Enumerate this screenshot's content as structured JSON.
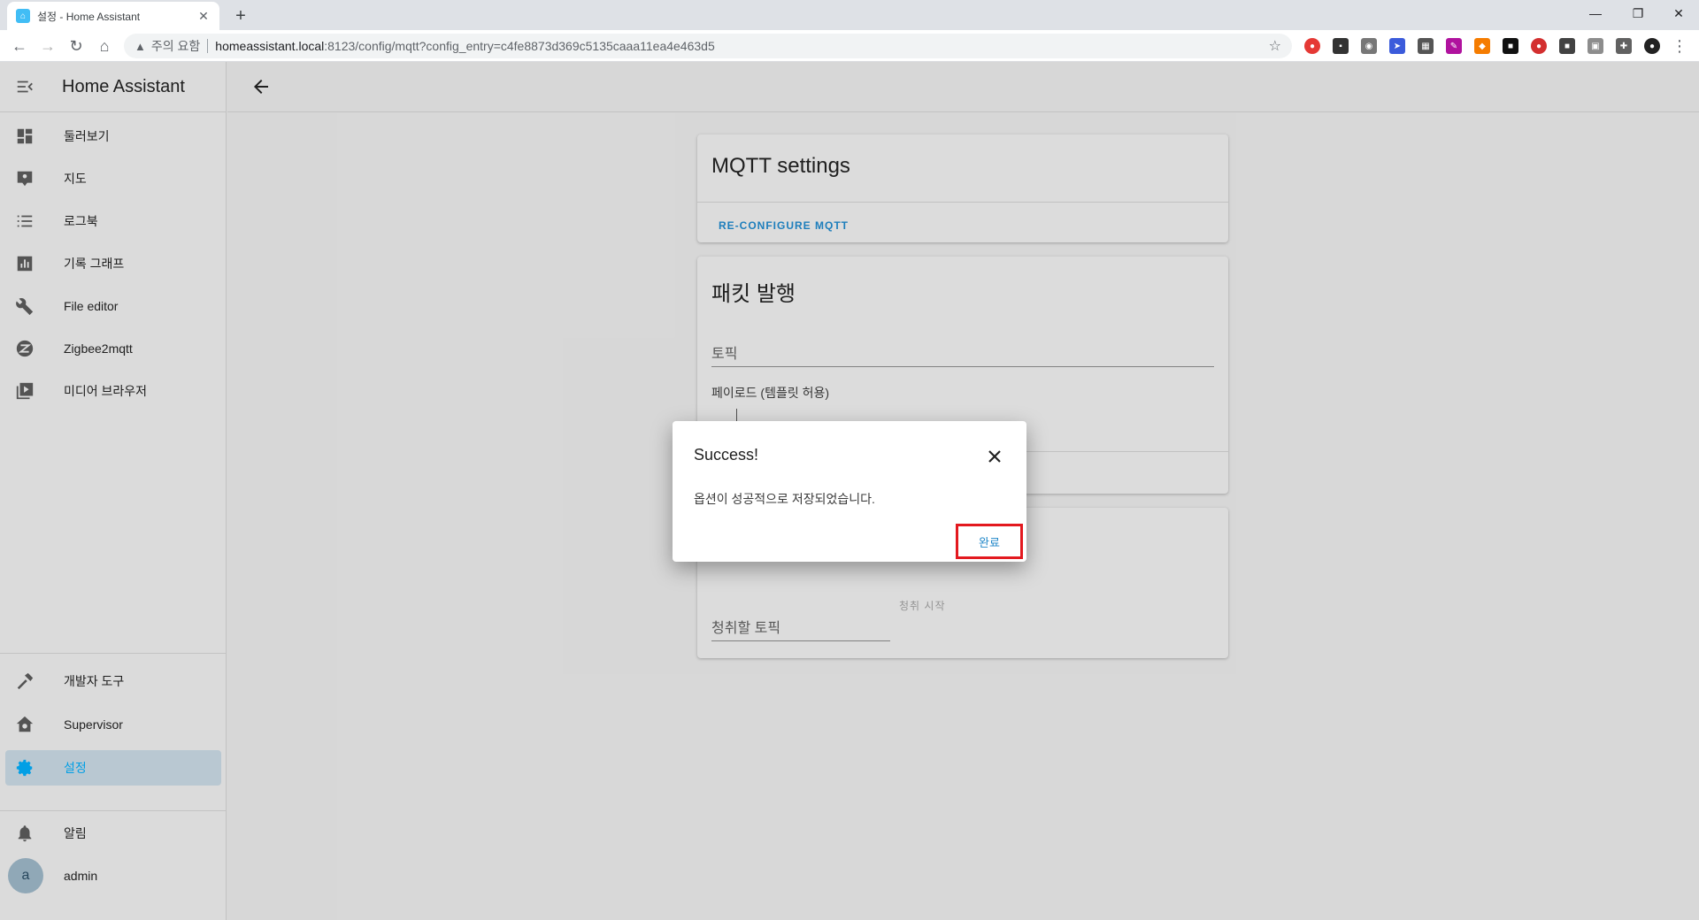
{
  "browser": {
    "tab_title": "설정 - Home Assistant",
    "tab_close": "✕",
    "new_tab": "+",
    "security_label": "주의 요함",
    "url_host": "homeassistant.local",
    "url_path": ":8123/config/mqtt?config_entry=c4fe8873d369c5135caaa11ea4e463d5"
  },
  "sidebar": {
    "title": "Home Assistant",
    "items": [
      {
        "label": "둘러보기",
        "icon": "dashboard-icon"
      },
      {
        "label": "지도",
        "icon": "map-icon"
      },
      {
        "label": "로그북",
        "icon": "logbook-icon"
      },
      {
        "label": "기록 그래프",
        "icon": "history-icon"
      },
      {
        "label": "File editor",
        "icon": "wrench-icon"
      },
      {
        "label": "Zigbee2mqtt",
        "icon": "zigbee-icon"
      },
      {
        "label": "미디어 브라우저",
        "icon": "media-icon"
      }
    ],
    "bottom_items": [
      {
        "label": "개발자 도구",
        "icon": "hammer-icon"
      },
      {
        "label": "Supervisor",
        "icon": "supervisor-icon"
      },
      {
        "label": "설정",
        "icon": "gear-icon"
      }
    ],
    "notifications_label": "알림",
    "user": {
      "avatar": "a",
      "name": "admin"
    }
  },
  "main": {
    "mqtt_card": {
      "title": "MQTT settings",
      "reconfigure_label": "RE-CONFIGURE MQTT"
    },
    "publish_card": {
      "title": "패킷 발행",
      "topic_placeholder": "토픽",
      "payload_label": "페이로드 (템플릿 허용)"
    },
    "listen_card": {
      "topic_placeholder": "청취할 토픽",
      "start_label": "청취 시작"
    }
  },
  "dialog": {
    "title": "Success!",
    "message": "옵션이 성공적으로 저장되었습니다.",
    "ok_label": "완료"
  },
  "colors": {
    "accent": "#03a9f4",
    "link": "#1f86c8",
    "highlight_box": "#e3191f"
  }
}
